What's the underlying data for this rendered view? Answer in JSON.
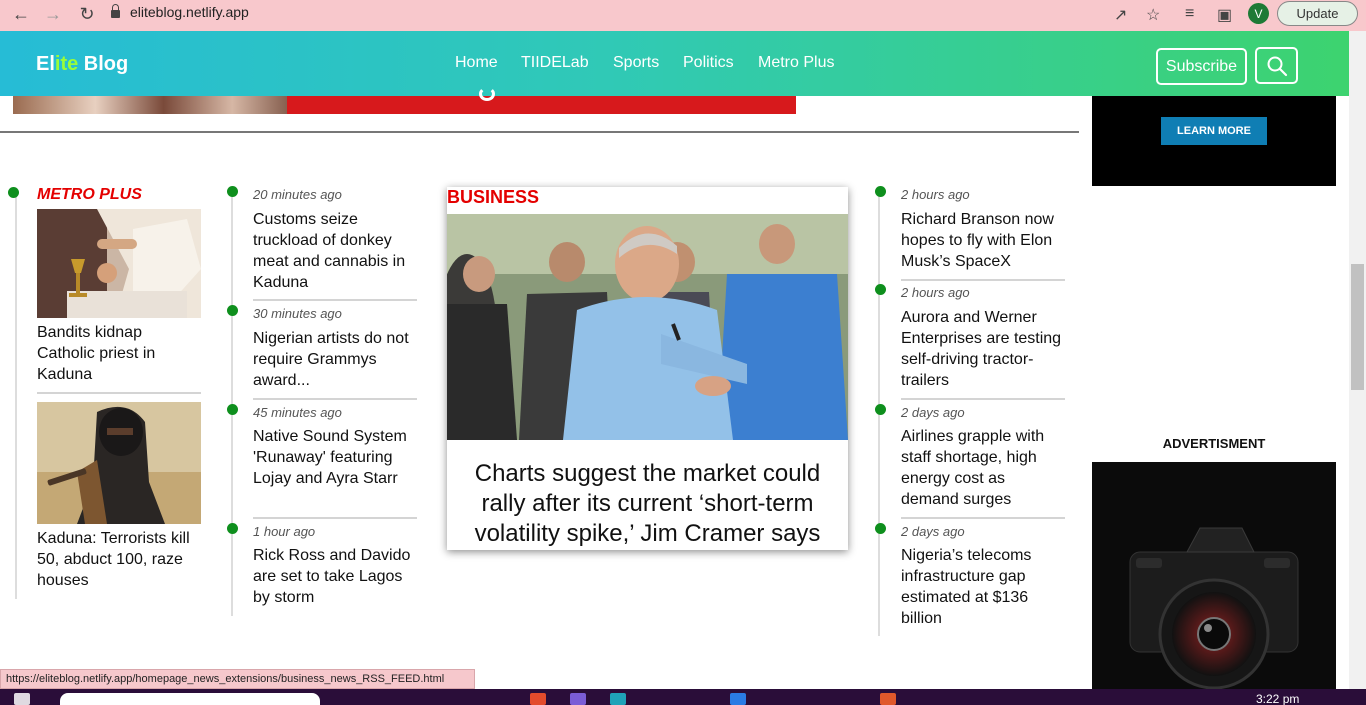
{
  "browser": {
    "url": "eliteblog.netlify.app",
    "update_label": "Update",
    "profile_initial": "V"
  },
  "header": {
    "logo_part1": "El",
    "logo_part2": "ite",
    "logo_part3": " Blog",
    "nav": [
      "Home",
      "TIIDELab",
      "Sports",
      "Politics",
      "Metro Plus"
    ],
    "subscribe_label": "Subscribe"
  },
  "sidebar_ads": {
    "learn_more": "LEARN MORE",
    "advert_title": "ADVERTISMENT"
  },
  "metro_plus": {
    "heading": "METRO PLUS",
    "items": [
      {
        "headline": "Bandits kidnap Catholic priest in Kaduna"
      },
      {
        "headline": "Kaduna: Terrorists kill 50, abduct 100, raze houses"
      }
    ]
  },
  "latest": [
    {
      "time": "20 minutes ago",
      "headline": "Customs seize truckload of donkey meat and cannabis in Kaduna"
    },
    {
      "time": "30 minutes ago",
      "headline": "Nigerian artists do not require Grammys award..."
    },
    {
      "time": "45 minutes ago",
      "headline": "Native Sound System 'Runaway' featuring Lojay and Ayra Starr"
    },
    {
      "time": "1 hour ago",
      "headline": "Rick Ross and Davido are set to take Lagos by storm"
    }
  ],
  "business": {
    "heading": "BUSINESS",
    "headline": "Charts suggest the market could rally after its current ‘short-term volatility spike,’ Jim Cramer says"
  },
  "right_news": [
    {
      "time": "2 hours ago",
      "headline": "Richard Branson now hopes to fly with Elon Musk’s SpaceX"
    },
    {
      "time": "2 hours ago",
      "headline": "Aurora and Werner Enterprises are testing self-driving tractor-trailers"
    },
    {
      "time": "2 days ago",
      "headline": "Airlines grapple with staff shortage, high energy cost as demand surges"
    },
    {
      "time": "2 days ago",
      "headline": "Nigeria’s telecoms infrastructure gap estimated at $136 billion"
    }
  ],
  "status_url": "https://eliteblog.netlify.app/homepage_news_extensions/business_news_RSS_FEED.html",
  "taskbar_time": "3:22 pm"
}
